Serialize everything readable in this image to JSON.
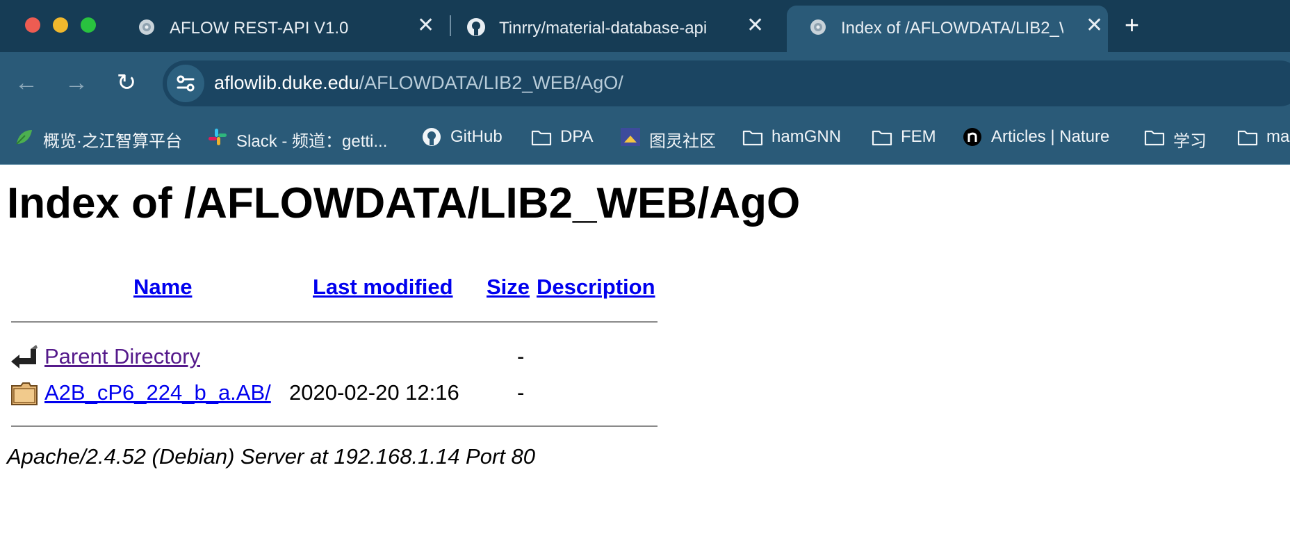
{
  "window": {
    "tabs": [
      {
        "title": "AFLOW REST-API V1.0",
        "favicon": "aflow-icon"
      },
      {
        "title": "Tinrry/material-database-api",
        "favicon": "github-icon"
      },
      {
        "title": "Index of /AFLOWDATA/LIB2_W",
        "favicon": "aflow-icon",
        "active": true
      }
    ],
    "close_glyph": "✕",
    "new_tab_glyph": "+"
  },
  "toolbar": {
    "back_glyph": "←",
    "forward_glyph": "→",
    "reload_glyph": "↻",
    "url_host": "aflowlib.duke.edu",
    "url_path": "/AFLOWDATA/LIB2_WEB/AgO/"
  },
  "bookmarks": [
    {
      "label": "概览·之江智算平台",
      "icon": "leaf-icon"
    },
    {
      "label": "Slack - 频道：getti...",
      "icon": "slack-icon"
    },
    {
      "label": "GitHub",
      "icon": "github-icon"
    },
    {
      "label": "DPA",
      "icon": "folder-icon"
    },
    {
      "label": "图灵社区",
      "icon": "turing-icon"
    },
    {
      "label": "hamGNN",
      "icon": "folder-icon"
    },
    {
      "label": "FEM",
      "icon": "folder-icon"
    },
    {
      "label": "Articles | Nature",
      "icon": "nature-icon"
    },
    {
      "label": "学习",
      "icon": "folder-icon"
    },
    {
      "label": "ma",
      "icon": "folder-icon"
    }
  ],
  "page": {
    "heading": "Index of /AFLOWDATA/LIB2_WEB/AgO",
    "columns": {
      "name": "Name",
      "modified": "Last modified",
      "size": "Size",
      "description": "Description"
    },
    "rows": [
      {
        "name": "Parent Directory",
        "modified": "",
        "size": "-",
        "icon": "back-arrow-icon",
        "visited": true
      },
      {
        "name": "A2B_cP6_224_b_a.AB/",
        "modified": "2020-02-20 12:16",
        "size": "-",
        "icon": "folder-icon",
        "visited": false
      }
    ],
    "footer": "Apache/2.4.52 (Debian) Server at 192.168.1.14 Port 80"
  },
  "colors": {
    "tabbar": "#163c55",
    "toolbar": "#2a5a78",
    "link": "#0000ee",
    "visited_link": "#551a8b"
  }
}
